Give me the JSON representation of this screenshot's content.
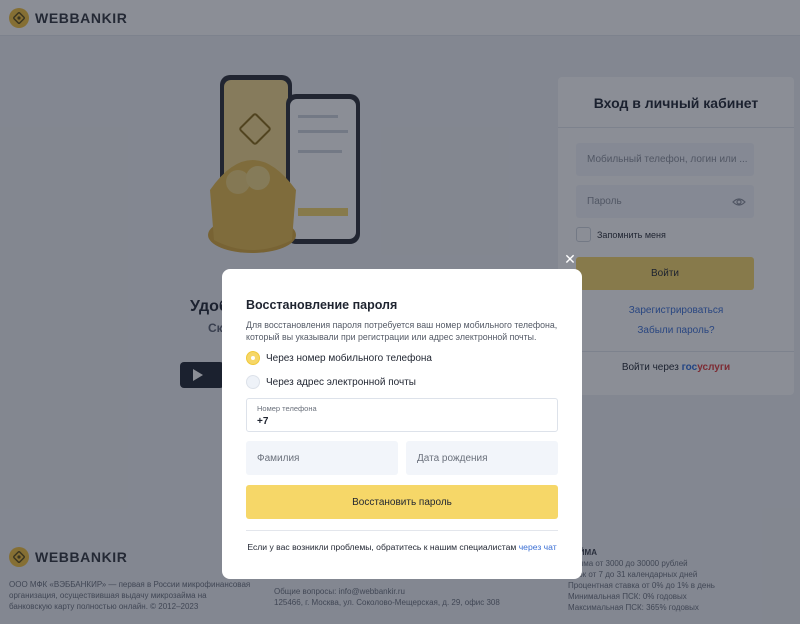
{
  "header": {
    "brand": "WEBBANKIR"
  },
  "hero": {
    "title": "Удоб",
    "subtitle": "Ск"
  },
  "login": {
    "title": "Вход в личный кабинет",
    "login_placeholder": "Мобильный телефон, логин или ...",
    "password_placeholder": "Пароль",
    "remember_label": "Запомнить меня",
    "submit_label": "Войти",
    "register_link": "Зарегистрироваться",
    "forgot_link": "Забыли пароль?",
    "gos_prefix": "Войти через",
    "gos_part1": "гос",
    "gos_part2": "услуги"
  },
  "footer": {
    "brand": "WEBBANKIR",
    "about": [
      "ООО МФК «ВЭББАНКИР» — первая в России микрофинансовая",
      "организация, осуществившая выдачу микрозайма на",
      "банковскую карту полностью онлайн. © 2012–2023"
    ],
    "contacts": [
      "Общие вопросы: info@webbankir.ru",
      "125466, г. Москва, ул. Соколово-Мещерская, д. 29, офис 308"
    ],
    "terms_heading": "ЗАЙМА",
    "terms": [
      "Сумма от 3000 до 30000 рублей",
      "Срок от 7 до 31 календарных дней",
      "Процентная ставка от 0% до 1% в день",
      "Минимальная ПСК: 0% годовых",
      "Максимальная ПСК: 365% годовых"
    ]
  },
  "modal": {
    "close_glyph": "✕",
    "title": "Восстановление пароля",
    "description": "Для восстановления пароля потребуется ваш номер мобильного телефона, который вы указывали при регистрации или адрес электронной почты.",
    "option_phone": "Через номер мобильного телефона",
    "option_email": "Через адрес электронной почты",
    "selected_option": "phone",
    "phone_label": "Номер телефона",
    "phone_value": "+7",
    "lastname_placeholder": "Фамилия",
    "birthdate_placeholder": "Дата рождения",
    "submit_label": "Восстановить пароль",
    "help_text": "Если у вас возникли проблемы, обратитесь к нашим специалистам",
    "help_link": "через чат"
  },
  "colors": {
    "accent": "#f6d768",
    "link": "#3b6fd4",
    "overlay": "rgba(24,30,45,0.5)"
  }
}
